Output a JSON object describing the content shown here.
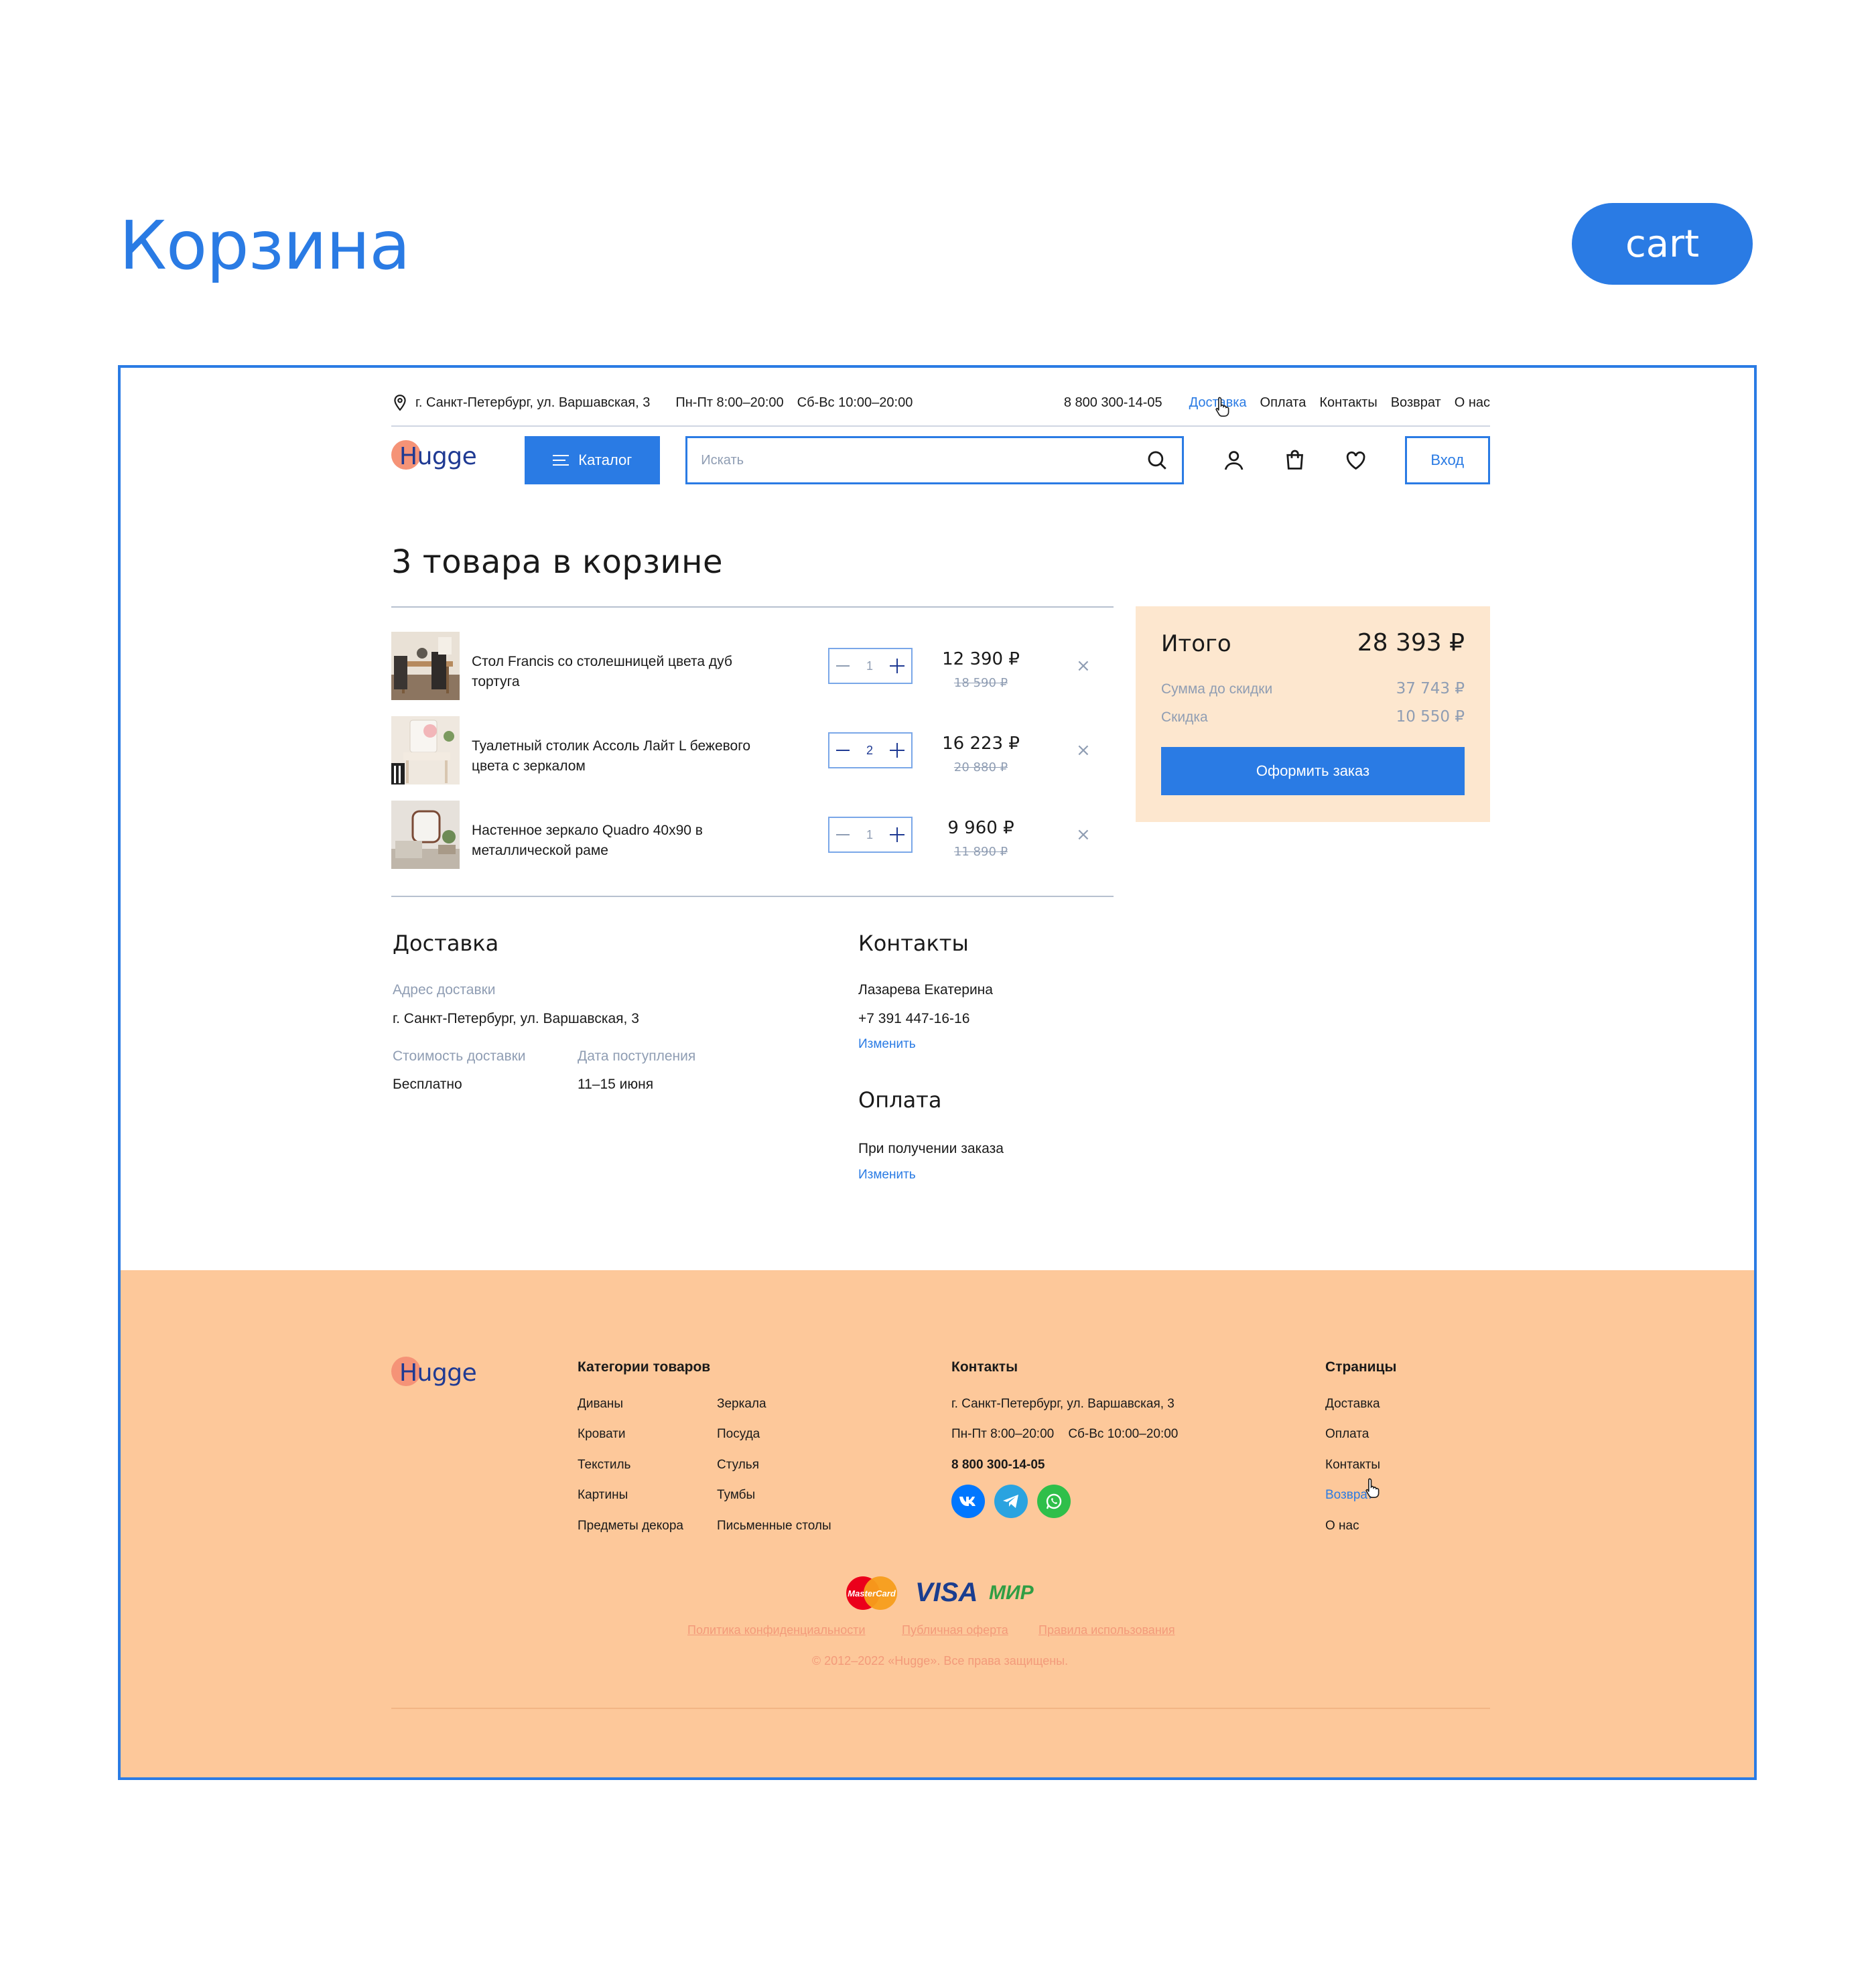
{
  "page": {
    "heading": "Корзина",
    "tag": "cart"
  },
  "topbar": {
    "address": "г. Санкт-Петербург, ул. Варшавская, 3",
    "hours_weekday": "Пн-Пт 8:00–20:00",
    "hours_weekend": "Сб-Вс 10:00–20:00",
    "phone": "8 800 300-14-05",
    "nav": [
      "Доставка",
      "Оплата",
      "Контакты",
      "Возврат",
      "О нас"
    ],
    "active_nav": "Доставка"
  },
  "header": {
    "logo": "Hugge",
    "catalog_label": "Каталог",
    "search_placeholder": "Искать",
    "login_label": "Вход"
  },
  "cart": {
    "title": "3 товара в корзине",
    "items": [
      {
        "name": "Стол Francis со столешницей цвета дуб тортуга",
        "qty": "1",
        "price": "12 390 ₽",
        "old_price": "18 590 ₽"
      },
      {
        "name": "Туалетный столик Ассоль Лайт L бежевого цвета с зеркалом",
        "qty": "2",
        "price": "16 223 ₽",
        "old_price": "20 880 ₽"
      },
      {
        "name": "Настенное зеркало Quadro 40х90 в металлической раме",
        "qty": "1",
        "price": "9 960 ₽",
        "old_price": "11 890 ₽"
      }
    ],
    "remove_symbol": "×"
  },
  "summary": {
    "total_label": "Итого",
    "total_value": "28 393 ₽",
    "subtotal_label": "Сумма до скидки",
    "subtotal_value": "37 743 ₽",
    "discount_label": "Скидка",
    "discount_value": "10 550 ₽",
    "order_button": "Оформить заказ"
  },
  "delivery": {
    "title": "Доставка",
    "address_label": "Адрес доставки",
    "address_value": "г. Санкт-Петербург, ул. Варшавская, 3",
    "cost_label": "Стоимость доставки",
    "cost_value": "Бесплатно",
    "date_label": "Дата поступления",
    "date_value": "11–15 июня"
  },
  "contacts": {
    "title": "Контакты",
    "name": "Лазарева Екатерина",
    "phone": "+7 391 447-16-16",
    "change": "Изменить"
  },
  "payment": {
    "title": "Оплата",
    "method": "При получении заказа",
    "change": "Изменить"
  },
  "footer": {
    "logo": "Hugge",
    "categories_title": "Категории товаров",
    "categories_col1": [
      "Диваны",
      "Кровати",
      "Текстиль",
      "Картины",
      "Предметы декора"
    ],
    "categories_col2": [
      "Зеркала",
      "Посуда",
      "Стулья",
      "Тумбы",
      "Письменные столы"
    ],
    "contacts_title": "Контакты",
    "address": "г. Санкт-Петербург, ул. Варшавская, 3",
    "hours": "Пн-Пт 8:00–20:00    Сб-Вс 10:00–20:00",
    "phone": "8 800 300-14-05",
    "social": [
      "VK",
      "Telegram",
      "WhatsApp"
    ],
    "pages_title": "Страницы",
    "pages": [
      "Доставка",
      "Оплата",
      "Контакты",
      "Возврат",
      "О нас"
    ],
    "active_page": "Возврат",
    "payment_logos": [
      "MasterCard",
      "VISA",
      "МИР"
    ],
    "legal": [
      "Политика конфиденциальности",
      "Публичная оферта",
      "Правила использования"
    ],
    "copyright": "© 2012–2022 «Hugge». Все права защищены."
  },
  "colors": {
    "accent": "#2a7be4",
    "summary_bg": "#fde7cf",
    "footer_bg": "#fdc89a",
    "muted": "#8f9db3",
    "logo_dot": "#f59377"
  }
}
